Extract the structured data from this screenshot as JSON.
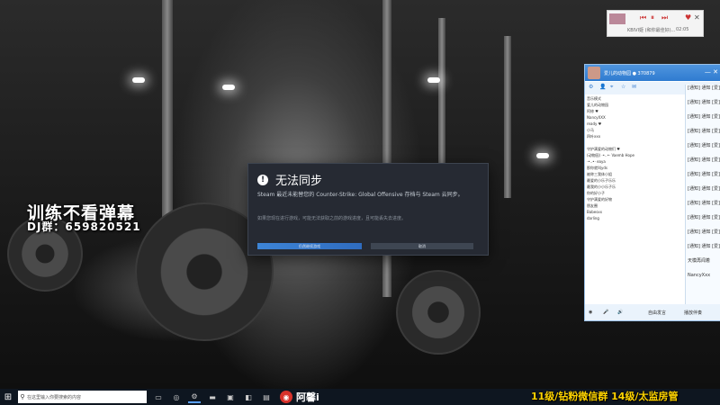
{
  "overlay": {
    "title": "训练不看弹幕",
    "group": "DJ群：659820521"
  },
  "music": {
    "song": "KBIVI姬 (和你最佳好)...",
    "time": "02:05"
  },
  "dialog": {
    "title": "无法同步",
    "message": "Steam 最近未能替您的 Counter-Strike: Global Offensive 存档与 Steam 云同步。",
    "detail": "如果您现在进行游戏，可能无法获取之前的游戏进度，且可能丢失去进度。",
    "primary_button": "仍然继续游戏",
    "secondary_button": "取消"
  },
  "chat": {
    "room_title": "爱儿的动物园 ● 370879",
    "tabs": [
      "音乐模式"
    ],
    "left_rows": [
      "爱儿的动物园",
      "阿修 ♥",
      "NancyXXX",
      "ready ♥",
      "小马",
      "四叶xxx",
      "",
      "守护满爱的动物们 ♥",
      "(动物园) ·•..•· Vaemb Hope",
      "·•..•· eaya",
      "那你就叫yds",
      "被称三我体小姐",
      "最爱的小乐子乐乐",
      "最我的小小乐子乐",
      "你的好小子",
      "守护满爱的好物",
      "朋友圈",
      "Babesxx",
      "darling"
    ],
    "right_rows": [
      "[通知] 通知 [爱]",
      "[通知] 通知 [爱]",
      "[通知] 通知 [爱]",
      "[通知] 通知 [爱]",
      "[通知] 通知 [爱]",
      "[通知] 通知 [爱]",
      "[通知] 通知 [爱]",
      "[通知] 通知 [爱]",
      "[通知] 通知 [爱]",
      "[通知] 通知 [爱]",
      "[通知] 通知 [爱]",
      "[通知] 通知 [爱]",
      "天模再闻着",
      "NancyXxx"
    ],
    "bottom": {
      "speak_label": "自由发言",
      "music_label": "播放伴奏"
    }
  },
  "taskbar": {
    "search_placeholder": "在这里输入你要搜索的内容",
    "streamer_name": "阿馨i",
    "ticker": "11级/钻粉微信群 14级/太监房管"
  }
}
